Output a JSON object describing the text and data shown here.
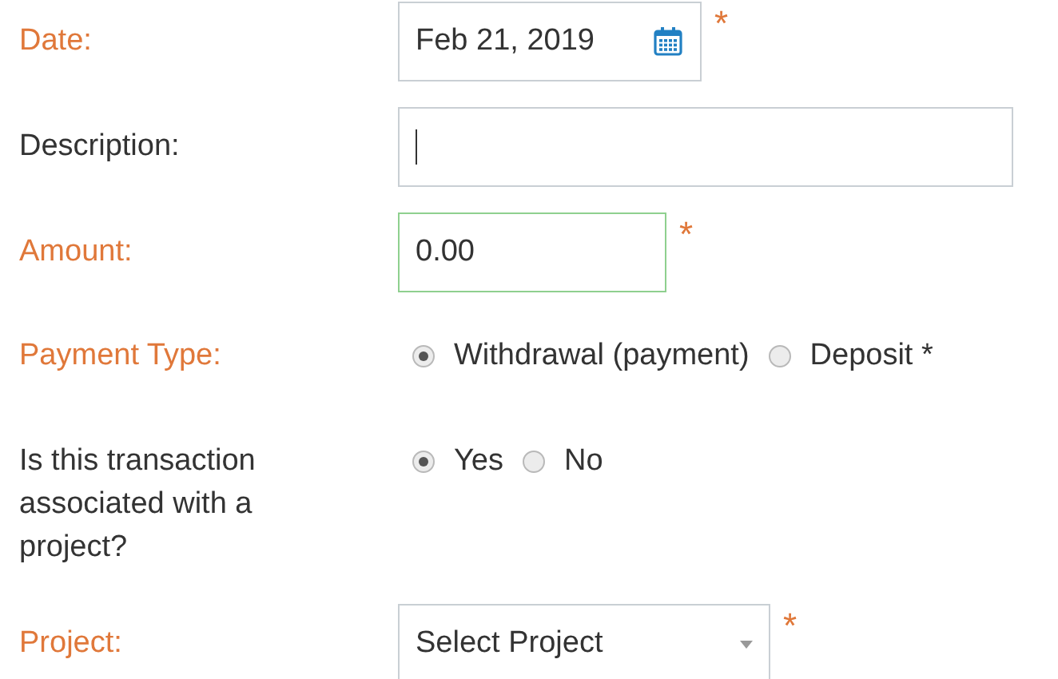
{
  "fields": [
    {
      "kind": "date",
      "label": "Date:",
      "required": true,
      "value": "Feb 21, 2019",
      "mark": "*"
    },
    {
      "kind": "text",
      "label": "Description:",
      "required": false,
      "focused": false
    },
    {
      "kind": "text",
      "label": "Amount:",
      "required": true,
      "value": "0.00",
      "focused": true,
      "mark": "*"
    },
    {
      "kind": "radio",
      "label": "Payment Type:",
      "required": true,
      "options": [
        {
          "label": "Withdrawal (payment)",
          "selected": true
        },
        {
          "label": "Deposit *",
          "selected": false
        }
      ]
    },
    {
      "kind": "radio",
      "label": "Is this transaction associated with a project?",
      "required": false,
      "options": [
        {
          "label": "Yes",
          "selected": true
        },
        {
          "label": "No",
          "selected": false
        }
      ]
    },
    {
      "kind": "select",
      "label": "Project:",
      "required": true,
      "value": "Select Project",
      "mark": "*"
    }
  ]
}
